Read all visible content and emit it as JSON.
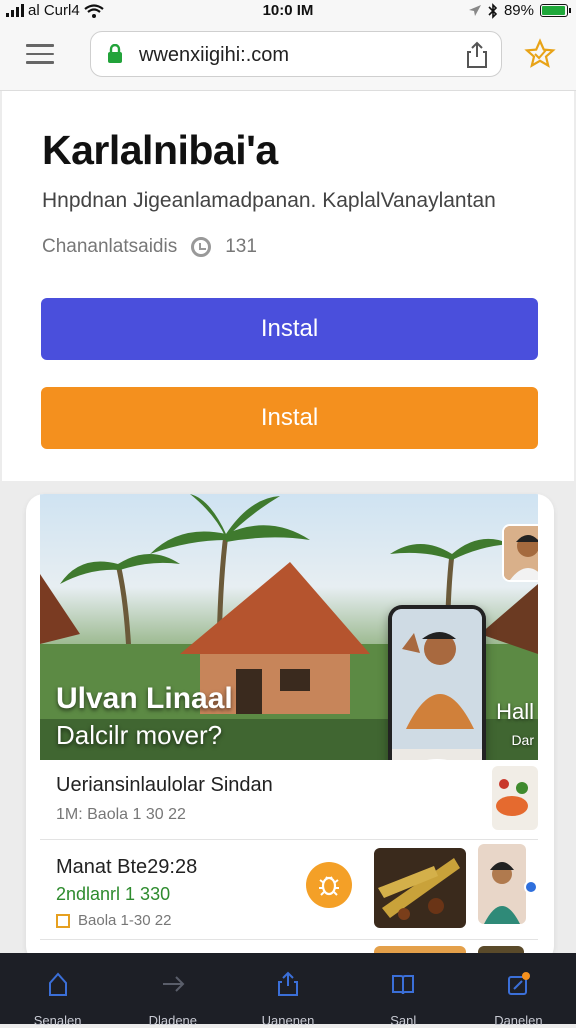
{
  "status_bar": {
    "carrier": "al Curl4",
    "time": "10:0 IM",
    "battery": "89%",
    "battery_level": 0.89
  },
  "browser": {
    "url": "wwenxiigihi:.com"
  },
  "app": {
    "title": "Karlalnibai'a",
    "subtitle": "Hnpdnan Jigeanlamadpanan. KaplalVanaylantan",
    "meta_label": "Chananlatsaidis",
    "meta_count": "131",
    "install_primary": "Instal",
    "install_secondary": "Instal"
  },
  "feed": {
    "hero_title": "Ulvan Linaal",
    "hero_subtitle": "Dalcilr mover?",
    "hero_side_1": "Hall",
    "hero_side_2": "Dar",
    "item1_title": "Ueriansinlaulolar Sindan",
    "item1_meta": "1M: Baola 1 30 22",
    "item2_title": "Manat Bte29:28",
    "item2_sub": "2ndlanrl 1 330",
    "item2_meta": "Baola 1-30 22"
  },
  "nav": [
    {
      "label": "Senalen",
      "icon": "home-icon"
    },
    {
      "label": "Dladene",
      "icon": "forward-arrow-icon"
    },
    {
      "label": "Uanenen",
      "icon": "share-icon"
    },
    {
      "label": "Sanl",
      "icon": "book-icon"
    },
    {
      "label": "Danelen",
      "icon": "notification-icon"
    }
  ],
  "colors": {
    "primary": "#4a4fdc",
    "secondary": "#f4901e",
    "nav_bg": "#1d1f26",
    "nav_icon": "#3b6fd8",
    "accent_orange": "#f4a027"
  }
}
